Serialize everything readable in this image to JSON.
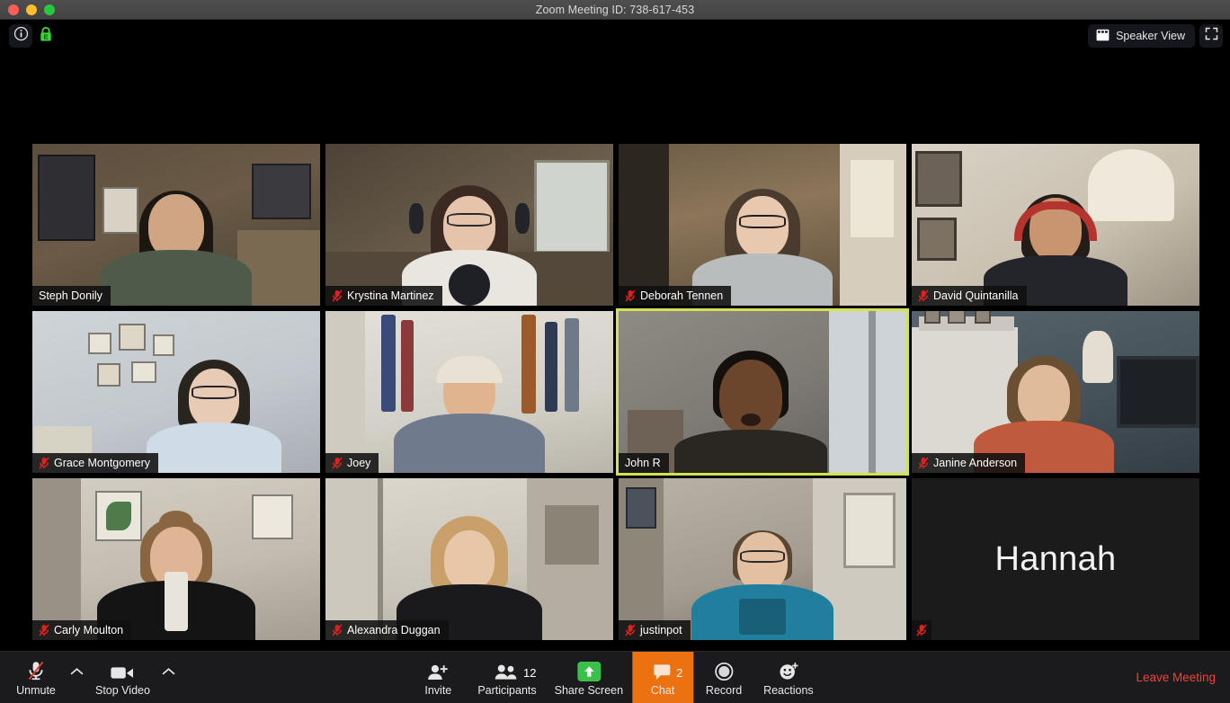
{
  "window": {
    "title": "Zoom Meeting ID: 738-617-453",
    "traffic_lights": [
      "close",
      "minimize",
      "zoom"
    ]
  },
  "topbar": {
    "info_icon": "info-circle-icon",
    "encryption_icon": "green-lock-icon",
    "view_button": {
      "label": "Speaker View",
      "icon": "grid-view-icon"
    },
    "fullscreen_icon": "fullscreen-icon"
  },
  "gallery": {
    "active_speaker": "John R",
    "participants": [
      {
        "name": "Steph Donily",
        "muted": false,
        "video_on": true,
        "active": false
      },
      {
        "name": "Krystina Martinez",
        "muted": true,
        "video_on": true,
        "active": false
      },
      {
        "name": "Deborah Tennen",
        "muted": true,
        "video_on": true,
        "active": false
      },
      {
        "name": "David Quintanilla",
        "muted": true,
        "video_on": true,
        "active": false
      },
      {
        "name": "Grace Montgomery",
        "muted": true,
        "video_on": true,
        "active": false
      },
      {
        "name": "Joey",
        "muted": true,
        "video_on": true,
        "active": false
      },
      {
        "name": "John R",
        "muted": false,
        "video_on": true,
        "active": true
      },
      {
        "name": "Janine Anderson",
        "muted": true,
        "video_on": true,
        "active": false
      },
      {
        "name": "Carly Moulton",
        "muted": true,
        "video_on": true,
        "active": false
      },
      {
        "name": "Alexandra Duggan",
        "muted": true,
        "video_on": true,
        "active": false
      },
      {
        "name": "justinpot",
        "muted": true,
        "video_on": true,
        "active": false
      },
      {
        "name": "Hannah",
        "muted": true,
        "video_on": false,
        "active": false
      }
    ]
  },
  "toolbar": {
    "audio": {
      "label": "Unmute",
      "icon": "microphone-muted-icon",
      "caret": "chevron-up-icon"
    },
    "video": {
      "label": "Stop Video",
      "icon": "camera-icon",
      "caret": "chevron-up-icon"
    },
    "invite": {
      "label": "Invite",
      "icon": "person-plus-icon"
    },
    "participants": {
      "label": "Participants",
      "icon": "people-icon",
      "count": "12"
    },
    "share": {
      "label": "Share Screen",
      "icon": "share-arrow-up-icon"
    },
    "chat": {
      "label": "Chat",
      "icon": "chat-bubble-icon",
      "count": "2",
      "highlighted": true
    },
    "record": {
      "label": "Record",
      "icon": "record-circle-icon"
    },
    "reactions": {
      "label": "Reactions",
      "icon": "smiley-plus-icon"
    },
    "leave": {
      "label": "Leave Meeting"
    }
  },
  "colors": {
    "accent_orange": "#ec7211",
    "active_border": "#d3e24f",
    "leave_red": "#e8453c",
    "share_green": "#3bc04a",
    "mute_red": "#e02020"
  }
}
